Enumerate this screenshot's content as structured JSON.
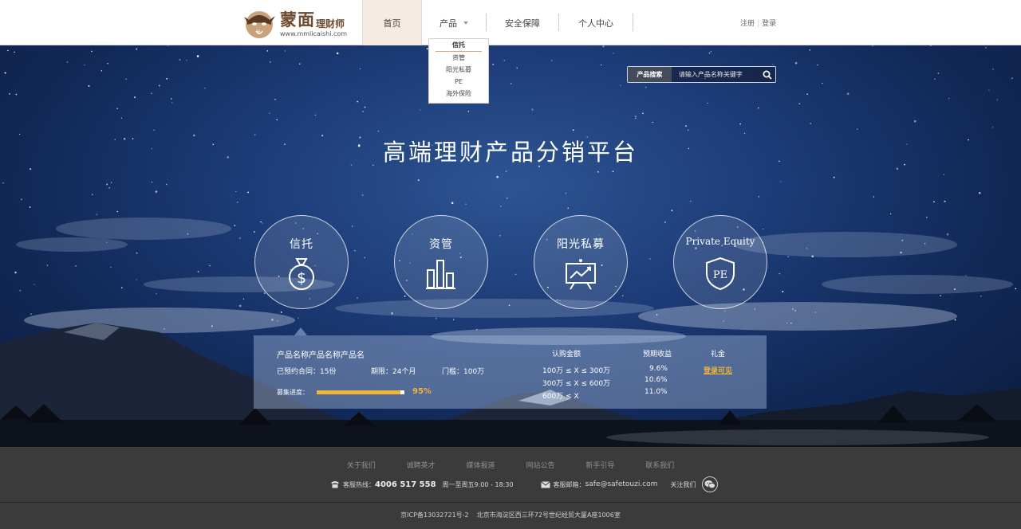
{
  "logo": {
    "name": "蒙面",
    "sub": "理财师",
    "url": "www.mmlicaishi.com"
  },
  "nav": {
    "home": "首页",
    "products": "产品",
    "security": "安全保障",
    "personal": "个人中心"
  },
  "auth": {
    "register": "注册",
    "login": "登录"
  },
  "dropdown": {
    "header": "信托",
    "items": [
      "资管",
      "阳光私募",
      "PE",
      "海外保险"
    ]
  },
  "search": {
    "label": "产品搜索",
    "placeholder": "请输入产品名称关键字"
  },
  "hero": {
    "title": "高端理财产品分销平台"
  },
  "categories": [
    {
      "label": "信托",
      "icon": "money-bag-icon"
    },
    {
      "label": "资管",
      "icon": "bar-chart-icon"
    },
    {
      "label": "阳光私募",
      "icon": "presentation-chart-icon"
    },
    {
      "label": "Private Equity",
      "icon": "pe-shield-icon"
    }
  ],
  "product": {
    "name": "产品名称产品名称产品名",
    "booked": "已预约合同：15份",
    "term": "期限：24个月",
    "threshold": "门槛：100万",
    "progress_label": "募集进度：",
    "progress": 0.95,
    "progress_text": "95%",
    "headers": {
      "amount": "认购金额",
      "yield": "预期收益",
      "gift": "礼金"
    },
    "tiers": [
      {
        "amount": "100万 ≤ X ≤ 300万",
        "yield": "9.6%"
      },
      {
        "amount": "300万 ≤ X ≤ 600万",
        "yield": "10.6%"
      },
      {
        "amount": "600万 ≤ X",
        "yield": "11.0%"
      }
    ],
    "gift_link": "登录可见"
  },
  "footer": {
    "links": [
      "关于我们",
      "诚聘英才",
      "媒体报道",
      "网站公告",
      "新手引导",
      "联系我们"
    ],
    "hotline_label": "客服热线：",
    "hotline": "4006 517 558",
    "hours": "周一至周五9:00 - 18:30",
    "email_label": "客服邮箱：",
    "email": "safe@safetouzi.com",
    "follow": "关注我们",
    "copyright": "京ICP备13032721号-2    北京市海淀区西三环72号世纪经贸大厦A座1006室"
  },
  "colors": {
    "brand": "#6e4a2f",
    "accent": "#f2b53a",
    "footer": "#3b3b3b"
  }
}
